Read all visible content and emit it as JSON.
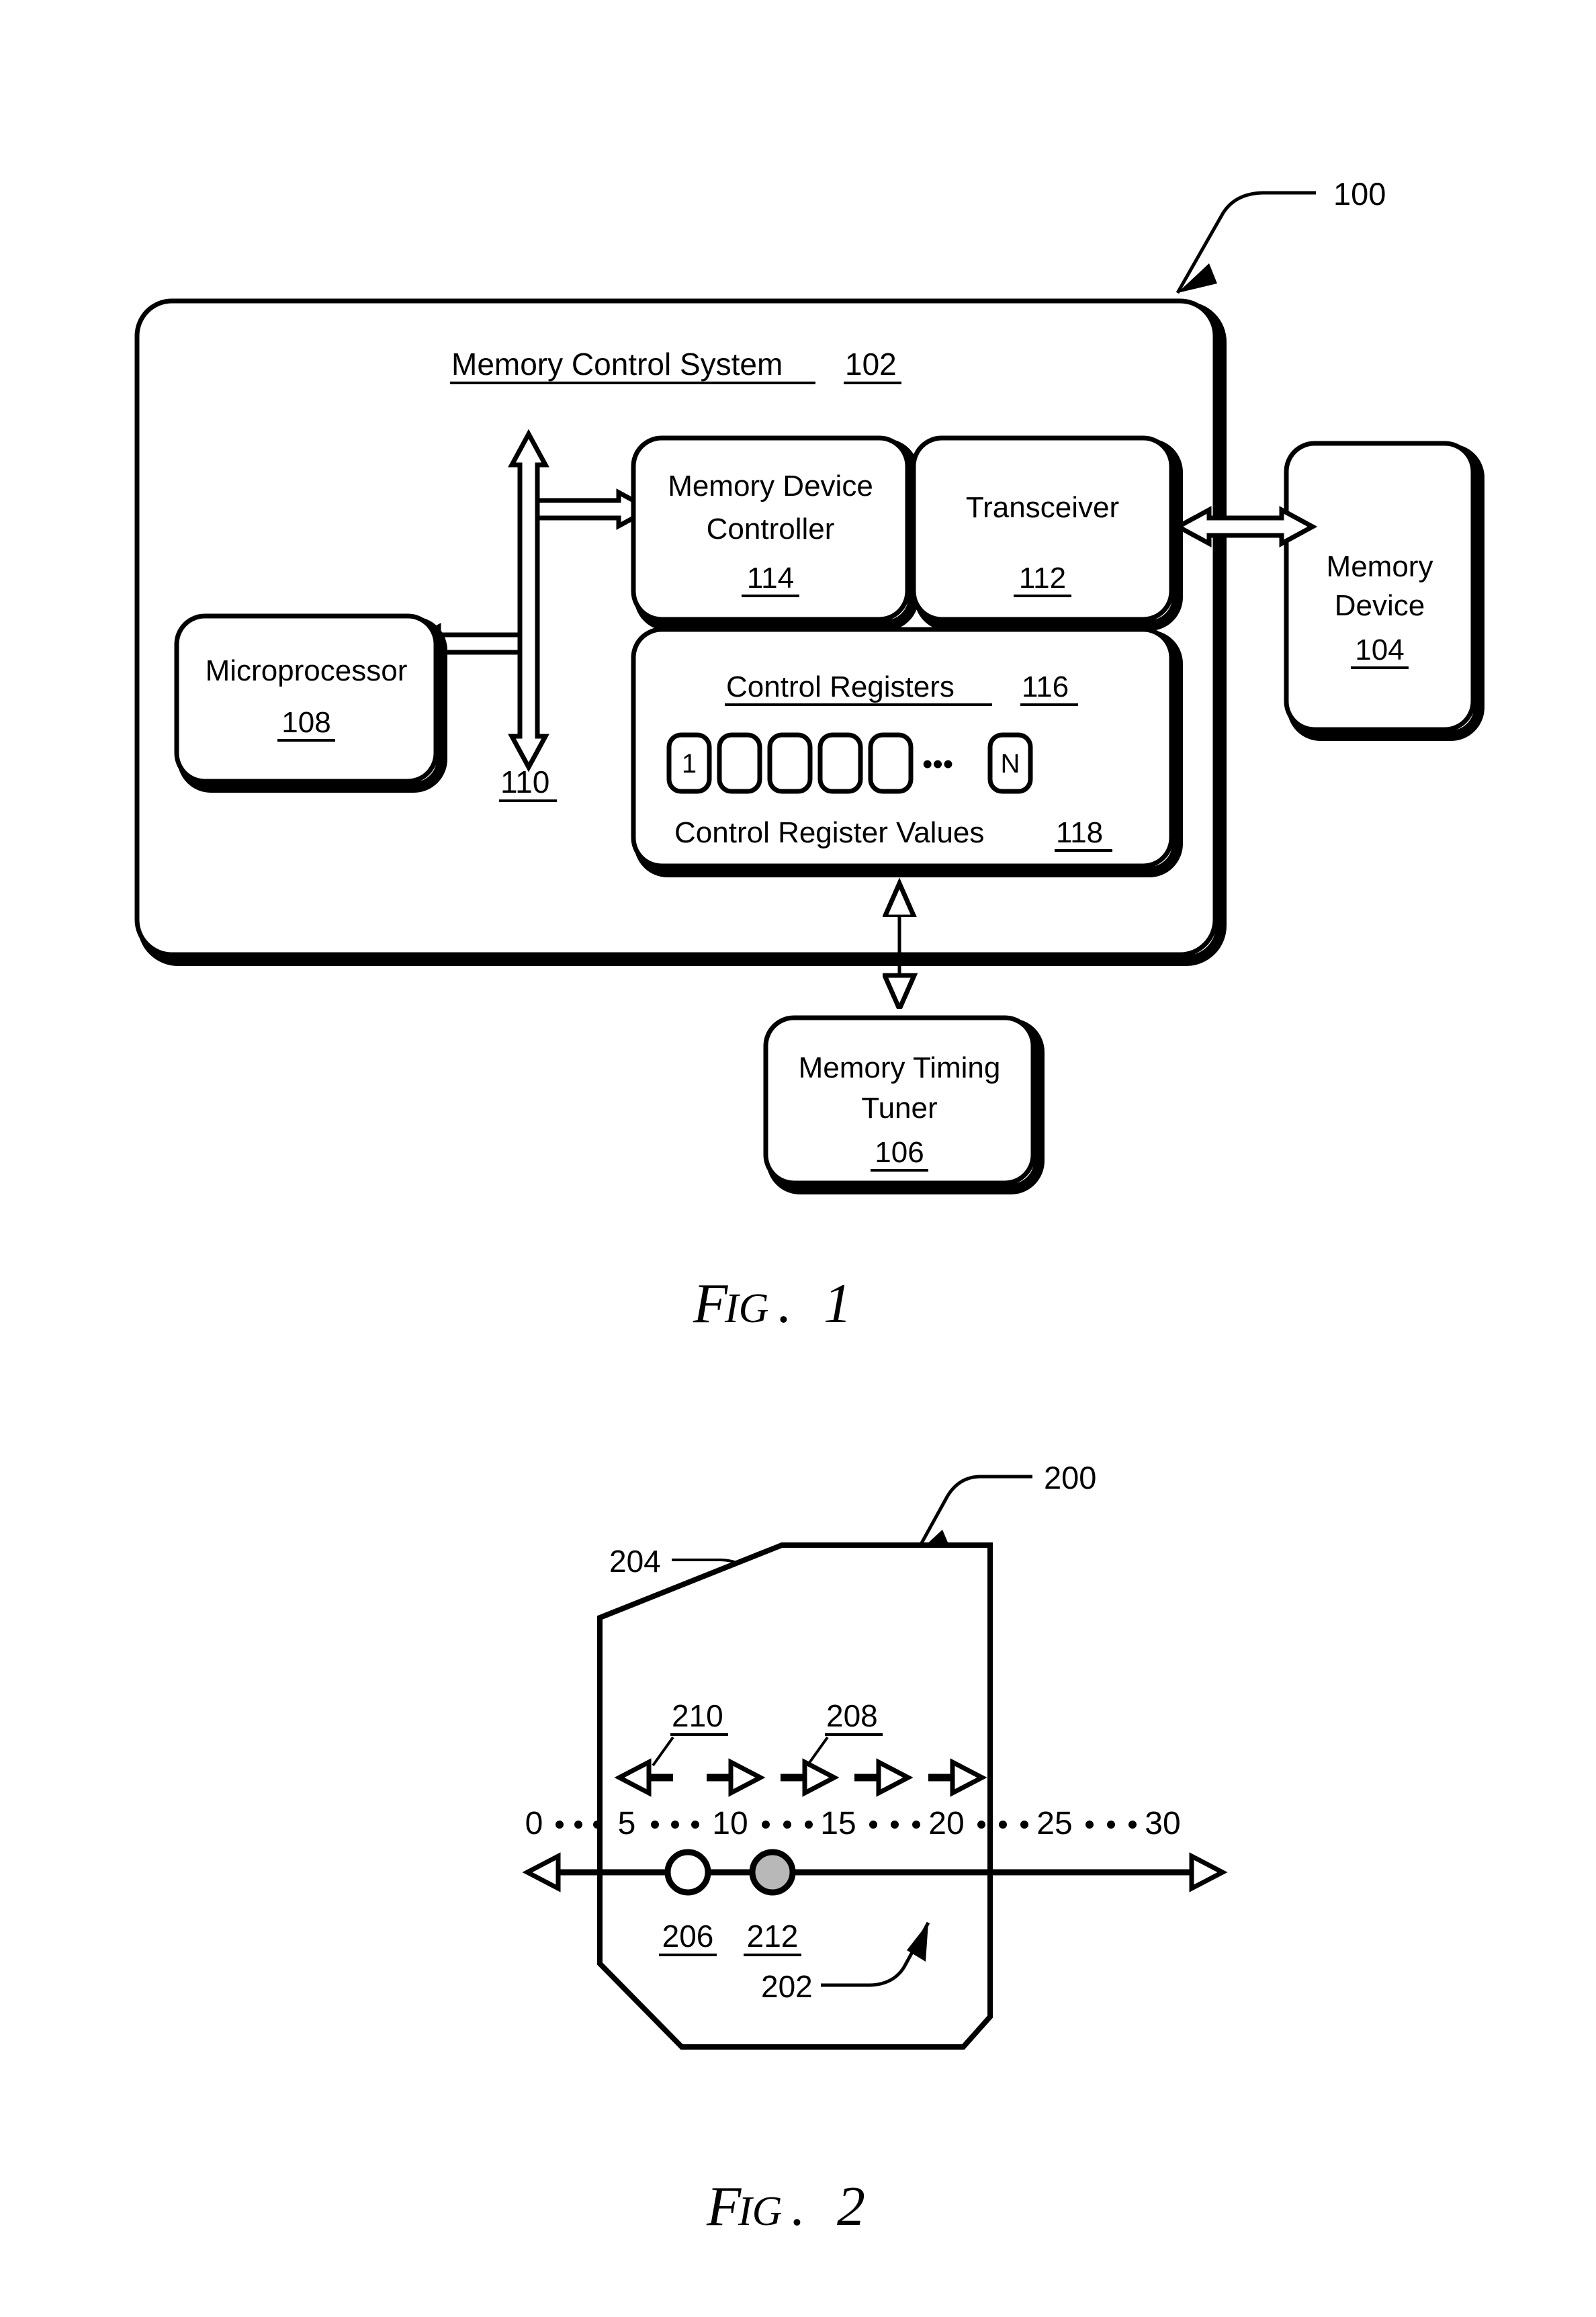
{
  "figures": [
    {
      "id": "fig1",
      "caption_main": "F",
      "caption_small": "IG",
      "caption_dot": ".",
      "caption_num": "1",
      "ref_label": "100",
      "system": {
        "title": "Memory Control System",
        "ref": "102"
      },
      "blocks": [
        {
          "key": "microprocessor",
          "name": "Microprocessor",
          "ref": "108"
        },
        {
          "key": "memory_device_controller",
          "name_line1": "Memory Device",
          "name_line2": "Controller",
          "ref": "114"
        },
        {
          "key": "transceiver",
          "name": "Transceiver",
          "ref": "112"
        },
        {
          "key": "memory_device",
          "name_line1": "Memory",
          "name_line2": "Device",
          "ref": "104"
        },
        {
          "key": "memory_timing_tuner",
          "name_line1": "Memory Timing",
          "name_line2": "Tuner",
          "ref": "106"
        }
      ],
      "control_registers": {
        "title": "Control Registers",
        "ref": "116",
        "values_title": "Control Register Values",
        "values_ref": "118",
        "cells": [
          "1",
          "",
          "",
          "",
          ""
        ],
        "ellipsis": "•••",
        "last_cell": "N"
      },
      "bus": {
        "ref": "110"
      }
    },
    {
      "id": "fig2",
      "caption_main": "F",
      "caption_small": "IG",
      "caption_dot": ".",
      "caption_num": "2",
      "ref_label": "200",
      "refs": {
        "window": "204",
        "diagram": "202",
        "current_value": "206",
        "selected_value": "212",
        "step_right": "208",
        "step_left": "210"
      },
      "number_line": {
        "labels": [
          "0",
          "5",
          "10",
          "15",
          "20",
          "25",
          "30"
        ],
        "dots_between": 4,
        "left_arrow": true,
        "right_arrow": true
      },
      "step_arrows": [
        {
          "dir": "left"
        },
        {
          "dir": "right"
        },
        {
          "dir": "right"
        },
        {
          "dir": "right"
        },
        {
          "dir": "right"
        }
      ],
      "markers": [
        {
          "ref": "206",
          "value": 7,
          "fill": "none"
        },
        {
          "ref": "212",
          "value": 11,
          "fill": "#b8b8b8"
        }
      ]
    }
  ],
  "colors": {
    "ink": "#000000",
    "paper": "#ffffff",
    "marker_fill": "#b8b8b8"
  }
}
